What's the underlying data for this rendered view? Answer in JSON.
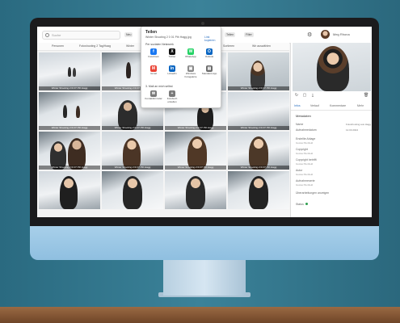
{
  "search": {
    "placeholder": "Suche"
  },
  "toolbar": {
    "chip_labels": [
      "Neu",
      "Teilen",
      "Filter"
    ]
  },
  "user": {
    "name": "Meg Rhona"
  },
  "filters": [
    {
      "label": "Personen"
    },
    {
      "label": "Fotoshooting 2 Tag/Haag"
    },
    {
      "label": "Winter"
    },
    {
      "label": "Orte"
    },
    {
      "label": "Kategorie"
    },
    {
      "label": "Sortieren"
    },
    {
      "label": "Wir auswählen"
    }
  ],
  "tile_caption": "Winter Shooting 2 0i 07 Pth Hagg",
  "share": {
    "title": "Teilen",
    "file": "Winter Shooting 2 0 01 Pth Hagg.jpg",
    "link_label": "Link kopieren",
    "section_social": "Per sozialen Netzwerk",
    "apps_row1": [
      {
        "label": "Facebook",
        "glyph": "f",
        "color": "#1877f2",
        "icon": "facebook-icon"
      },
      {
        "label": "Twitter",
        "glyph": "X",
        "color": "#111111",
        "icon": "x-icon"
      },
      {
        "label": "WhatsApp",
        "glyph": "W",
        "color": "#25d366",
        "icon": "whatsapp-icon"
      },
      {
        "label": "Outlook",
        "glyph": "O",
        "color": "#0a66c2",
        "icon": "outlook-icon"
      }
    ],
    "apps_row2": [
      {
        "label": "Gmail",
        "glyph": "M",
        "color": "#ea4335",
        "icon": "gmail-icon"
      },
      {
        "label": "LinkedIn",
        "glyph": "in",
        "color": "#0a66c2",
        "icon": "linkedin-icon"
      },
      {
        "label": "Windows Fotogalerie",
        "glyph": "▣",
        "color": "#8a8a8a",
        "icon": "gallery-icon"
      },
      {
        "label": "Standard-App",
        "glyph": "▤",
        "color": "#6d6d6d",
        "icon": "app-icon"
      }
    ],
    "section_more": "3. Mail an mich selbst",
    "apps_row3": [
      {
        "label": "Kontaktformular",
        "glyph": "✉",
        "color": "#7a7a7a",
        "icon": "mail-icon"
      },
      {
        "label": "Fotobuch erstellen",
        "glyph": "+",
        "color": "#7a7a7a",
        "icon": "plus-icon"
      }
    ]
  },
  "sidebar": {
    "tabs": [
      "Infos",
      "Verlauf",
      "Kommentare",
      "Mehr"
    ],
    "section_title": "Metadaten",
    "fields": [
      {
        "label": "Name",
        "value": "Fotoshooting aus Hagg"
      },
      {
        "label": "Aufnahmedatum",
        "value": "12.03.2024"
      },
      {
        "label": "Erstellte Ablage",
        "value": "Gustav Bonfield"
      },
      {
        "label": "Copyright",
        "value": "Gustav Bonfield"
      },
      {
        "label": "Copyright betrifft",
        "value": "Gustav Bonfield"
      },
      {
        "label": "Autor",
        "value": "Gustav Bonfield"
      },
      {
        "label": "Aufnahmeserie",
        "value": "Gustav Bonfield"
      }
    ],
    "overlay_label": "Überarbeitungen anzeigen",
    "status_label": "Status"
  },
  "colors": {
    "accent": "#2a6fc0",
    "status": "#2e9e4f"
  }
}
